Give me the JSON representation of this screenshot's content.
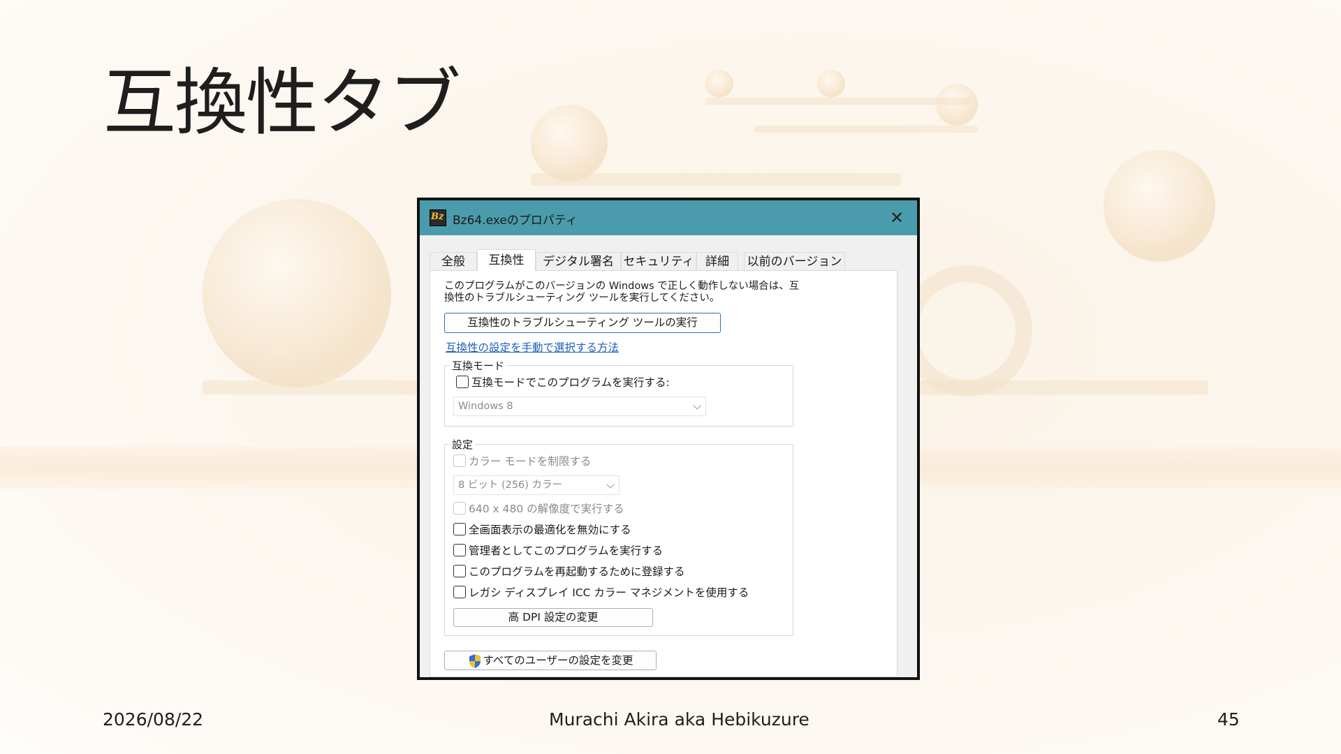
{
  "slide": {
    "title": "互換性タブ",
    "footer_date": "2026/08/22",
    "footer_author": "Murachi Akira aka Hebikuzure",
    "page_number": "45"
  },
  "window": {
    "title": "Bz64.exeのプロパティ",
    "icon_text": "Bz",
    "close_glyph": "✕",
    "accent_color": "#4a9cac"
  },
  "tabs": [
    {
      "label": "全般",
      "active": false
    },
    {
      "label": "互換性",
      "active": true
    },
    {
      "label": "デジタル署名",
      "active": false
    },
    {
      "label": "セキュリティ",
      "active": false
    },
    {
      "label": "詳細",
      "active": false
    },
    {
      "label": "以前のバージョン",
      "active": false
    }
  ],
  "compat": {
    "description": "このプログラムがこのバージョンの Windows で正しく動作しない場合は、互換性のトラブルシューティング ツールを実行してください。",
    "troubleshoot_button": "互換性のトラブルシューティング ツールの実行",
    "manual_link": "互換性の設定を手動で選択する方法",
    "mode_group": {
      "label": "互換モード",
      "checkbox": "互換モードでこのプログラムを実行する:",
      "os_select": "Windows 8"
    },
    "settings_group": {
      "label": "設定",
      "color_mode": "カラー モードを制限する",
      "color_select": "8 ビット (256) カラー",
      "res_640": "640 x 480 の解像度で実行する",
      "fullscreen_opt": "全画面表示の最適化を無効にする",
      "run_admin": "管理者としてこのプログラムを実行する",
      "register_restart": "このプログラムを再起動するために登録する",
      "legacy_icc": "レガシ ディスプレイ ICC カラー マネジメントを使用する",
      "dpi_button": "高 DPI 設定の変更"
    },
    "all_users_button": "すべてのユーザーの設定を変更"
  }
}
